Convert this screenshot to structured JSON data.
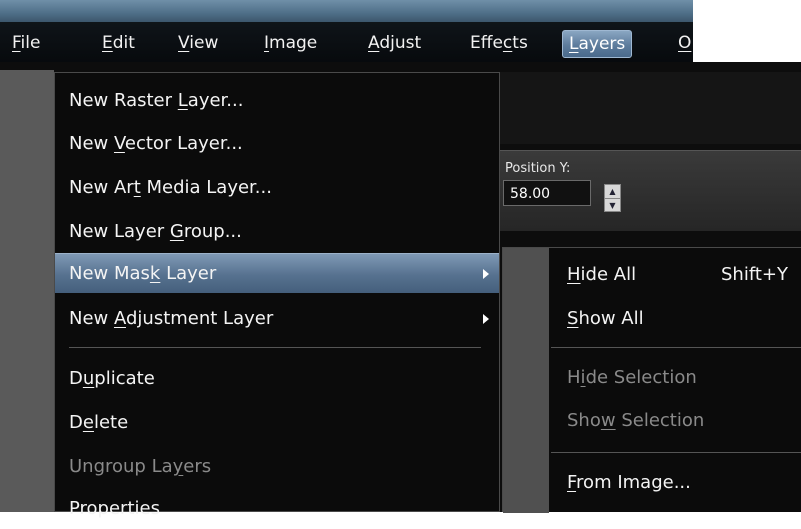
{
  "menubar": {
    "items": [
      {
        "label": "File",
        "u": "F",
        "rest": "ile"
      },
      {
        "label": "Edit",
        "u": "E",
        "rest": "dit"
      },
      {
        "label": "View",
        "u": "V",
        "rest": "iew"
      },
      {
        "label": "Image",
        "u": "I",
        "rest": "mage"
      },
      {
        "label": "Adjust",
        "u": "A",
        "rest": "djust"
      },
      {
        "label": "Effects",
        "pre": "Effe",
        "u": "c",
        "rest": "ts"
      },
      {
        "label": "Layers",
        "u": "L",
        "rest": "ayers"
      },
      {
        "label": "O",
        "u": "O",
        "rest": ""
      }
    ]
  },
  "toolbar": {
    "position_y_label": "Position Y:",
    "position_y_value": "58.00"
  },
  "layers_menu": {
    "new_raster": {
      "pre": "New Raster ",
      "u": "L",
      "post": "ayer..."
    },
    "new_vector": {
      "pre": "New ",
      "u": "V",
      "post": "ector Layer..."
    },
    "new_art_media": {
      "pre": "New Ar",
      "u": "t",
      "post": " Media Layer..."
    },
    "new_group": {
      "pre": "New Layer ",
      "u": "G",
      "post": "roup..."
    },
    "new_mask": {
      "pre": "New Mas",
      "u": "k",
      "post": " Layer"
    },
    "new_adjustment": {
      "pre": "New ",
      "u": "A",
      "post": "djustment Layer"
    },
    "duplicate": {
      "pre": "D",
      "u": "u",
      "post": "plicate"
    },
    "delete": {
      "pre": "D",
      "u": "e",
      "post": "lete"
    },
    "ungroup": {
      "pre": "Ungroup La",
      "u": "y",
      "post": "ers"
    },
    "properties": {
      "pre": "Properties",
      "u": "",
      "post": ""
    }
  },
  "mask_submenu": {
    "hide_all": {
      "pre": "",
      "u": "H",
      "post": "ide All",
      "shortcut": "Shift+Y"
    },
    "show_all": {
      "pre": "",
      "u": "S",
      "post": "how All"
    },
    "hide_selection": {
      "pre": "H",
      "u": "i",
      "post": "de Selection"
    },
    "show_selection": {
      "pre": "Sho",
      "u": "w",
      "post": " Selection"
    },
    "from_image": {
      "pre": "",
      "u": "F",
      "post": "rom Image..."
    }
  }
}
